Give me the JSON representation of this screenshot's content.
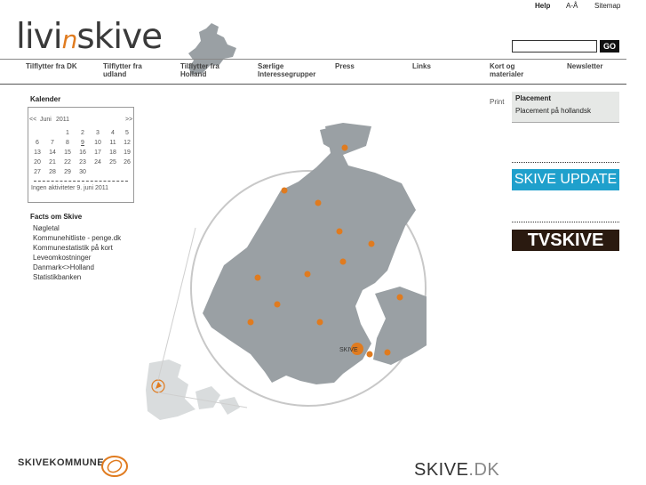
{
  "logo": {
    "part1": "livi",
    "part2": "n",
    "part3": "skive"
  },
  "top_links": {
    "help": "Help",
    "a_a": "A-Å",
    "sitemap": "Sitemap"
  },
  "search": {
    "placeholder": "",
    "button_label": "GO"
  },
  "nav": {
    "items": [
      {
        "label": "Tilflytter fra DK"
      },
      {
        "label": "Tilflytter fra udland"
      },
      {
        "label": "Tilflytter fra Holland"
      },
      {
        "label": "Særlige Interessegrupper"
      },
      {
        "label": "Press"
      },
      {
        "label": "Links"
      },
      {
        "label": "Kort og materialer"
      },
      {
        "label": "Newsletter"
      }
    ]
  },
  "calendar": {
    "title": "Kalender",
    "prev": "<<",
    "month": "Juni",
    "year": "2011",
    "next": ">>",
    "weeks": [
      [
        "",
        "",
        "1",
        "2",
        "3",
        "4",
        "5"
      ],
      [
        "6",
        "7",
        "8",
        "9",
        "10",
        "11",
        "12"
      ],
      [
        "13",
        "14",
        "15",
        "16",
        "17",
        "18",
        "19"
      ],
      [
        "20",
        "21",
        "22",
        "23",
        "24",
        "25",
        "26"
      ],
      [
        "27",
        "28",
        "29",
        "30",
        "",
        "",
        ""
      ]
    ],
    "note": "Ingen aktiviteter 9. juni 2011"
  },
  "facts": {
    "title": "Facts om Skive",
    "links": [
      {
        "label": "Nøgletal"
      },
      {
        "label": "Kommunehitliste - penge.dk"
      },
      {
        "label": "Kommunestatistik på kort"
      },
      {
        "label": "Leveomkostninger"
      },
      {
        "label": "Danmark<>Holland"
      },
      {
        "label": "Statistikbanken"
      }
    ]
  },
  "right": {
    "print": "Print",
    "placement_title": "Placement",
    "placement_link": "Placement på hollandsk",
    "skive_update": "SKIVE UPDATE",
    "tv_part1": "TV",
    "tv_part2": "SKIVE"
  },
  "map": {
    "main_label": "SKIVE",
    "colors": {
      "land": "#9aa0a4",
      "marker": "#e07b1f",
      "circle": "#bfbfbf"
    }
  },
  "footer": {
    "kommune_part1": "SKIVE",
    "kommune_part2": "KOMMUNE",
    "skivedk_part1": "SKIVE",
    "skivedk_part2": ".DK"
  }
}
